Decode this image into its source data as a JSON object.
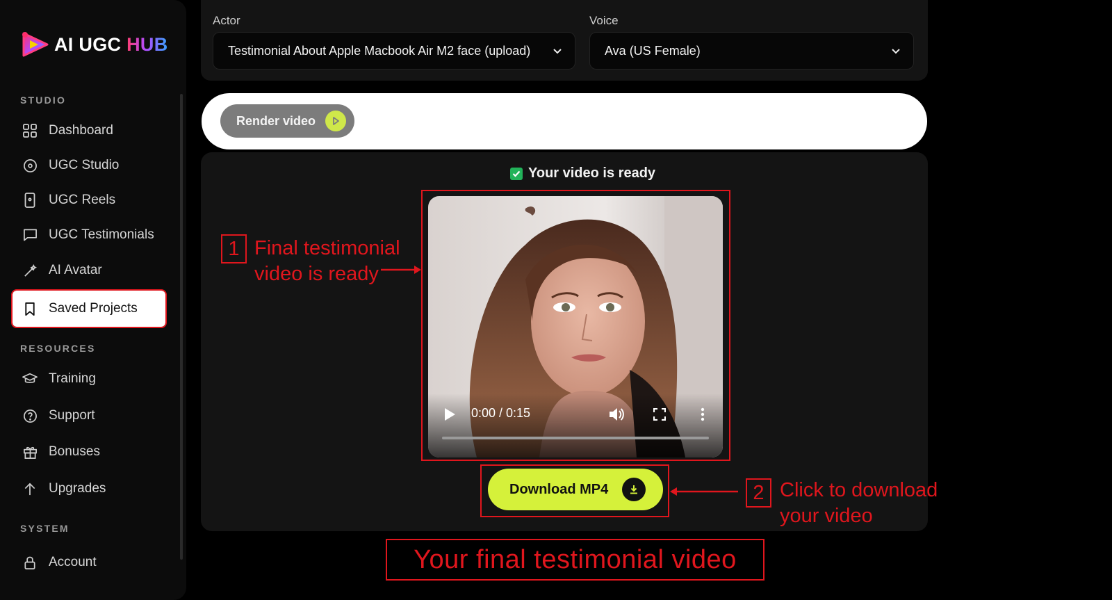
{
  "brand": {
    "name_white": "AI UGC",
    "name_accent": "HUB"
  },
  "sidebar": {
    "sections": [
      {
        "label": "STUDIO"
      },
      {
        "label": "RESOURCES"
      },
      {
        "label": "SYSTEM"
      }
    ],
    "items": [
      {
        "label": "Dashboard",
        "icon": "grid-icon"
      },
      {
        "label": "UGC Studio",
        "icon": "disc-icon"
      },
      {
        "label": "UGC Reels",
        "icon": "phone-icon"
      },
      {
        "label": "UGC Testimonials",
        "icon": "chat-icon"
      },
      {
        "label": "AI Avatar",
        "icon": "wand-icon"
      },
      {
        "label": "Saved Projects",
        "icon": "bookmark-icon",
        "active": true
      },
      {
        "label": "Training",
        "icon": "graduation-cap-icon"
      },
      {
        "label": "Support",
        "icon": "help-circle-icon"
      },
      {
        "label": "Bonuses",
        "icon": "gift-icon"
      },
      {
        "label": "Upgrades",
        "icon": "arrow-up-icon"
      },
      {
        "label": "Account",
        "icon": "lock-icon"
      }
    ]
  },
  "form": {
    "actor_label": "Actor",
    "actor_value": "Testimonial About Apple Macbook Air M2 face (upload)",
    "voice_label": "Voice",
    "voice_value": "Ava (US Female)"
  },
  "render": {
    "button_label": "Render video"
  },
  "result": {
    "status_text": "Your video is ready",
    "player_time": "0:00 / 0:15",
    "download_label": "Download MP4"
  },
  "annotations": {
    "one_number": "1",
    "one_line1": "Final testimonial",
    "one_line2": "video is ready",
    "two_number": "2",
    "two_line1": "Click to download",
    "two_line2": "your video",
    "caption": "Your final testimonial video"
  },
  "colors": {
    "accent_lime": "#d5f13a",
    "annotation_red": "#e0161d",
    "check_green": "#22b35a"
  }
}
